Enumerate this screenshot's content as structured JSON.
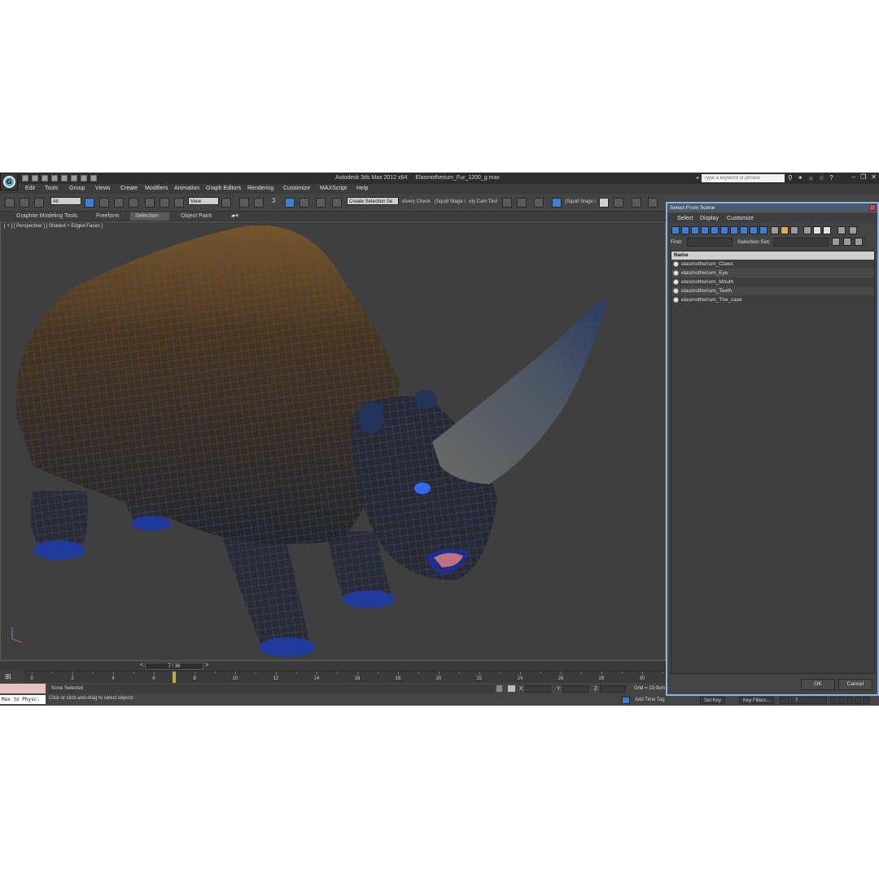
{
  "window": {
    "app_title": "Autodesk 3ds Max  2012 x64",
    "file_name": "Elasmotherium_Fur_1200_g.max",
    "search_placeholder": "Type a keyword or phrase"
  },
  "menu": [
    "Edit",
    "Tools",
    "Group",
    "Views",
    "Create",
    "Modifiers",
    "Animation",
    "Graph Editors",
    "Rendering",
    "Customize",
    "MAXScript",
    "Help"
  ],
  "toolbar": {
    "filter_dropdown": "All",
    "ref_coord_dropdown": "View",
    "selection_set_dropdown": "Create Selection Se",
    "snap_label": "3",
    "text_1": "elvery Check",
    "text_2": "(Squid Stage \\",
    "text_3": "uty Cam Tool",
    "text_4": "(Squid Stage \\"
  },
  "ribbon_tabs": [
    "Graphite Modeling Tools",
    "Freeform",
    "Selection",
    "Object Paint"
  ],
  "ribbon_active_index": 2,
  "viewport": {
    "label": "[ + ] [ Perspective ] [ Shaded + Edged Faces ]"
  },
  "time_slider": {
    "frame": "7 / 36",
    "prev": "<",
    "next": ">"
  },
  "timeline": {
    "ticks": [
      "0",
      "2",
      "4",
      "6",
      "8",
      "10",
      "12",
      "14",
      "16",
      "18",
      "20",
      "22",
      "24",
      "26",
      "28",
      "30"
    ],
    "current_frame": 7
  },
  "status": {
    "script_listener": "Max to Physc.",
    "selection_status": "None Selected",
    "prompt": "Click or click-and-drag to select objects",
    "x_label": "X:",
    "y_label": "Y:",
    "z_label": "Z:",
    "grid": "Grid = 10,0cm",
    "add_time_tag": "Add Time Tag",
    "set_key": "Set Key",
    "key_filters": "Key Filters...",
    "frame_field": "7"
  },
  "dialog": {
    "title": "Select From Scene",
    "menu": [
      "Select",
      "Display",
      "Customize"
    ],
    "find_label": "Find:",
    "selection_set_label": "Selection Set:",
    "column_header": "Name",
    "items": [
      "elasmotherium_Claws",
      "elasmotherium_Eye",
      "elasmotherium_Mouth",
      "elasmotherium_Teeth",
      "elasmotherium_The_case"
    ],
    "ok_label": "OK",
    "cancel_label": "Cancel"
  },
  "colors": {
    "accent_blue": "#3d7fd0",
    "wireframe_blue": "#2a5fd8",
    "body_brown": "#4a3418",
    "dialog_border": "#89b4e2",
    "timeline_cursor": "#c8a64a"
  }
}
